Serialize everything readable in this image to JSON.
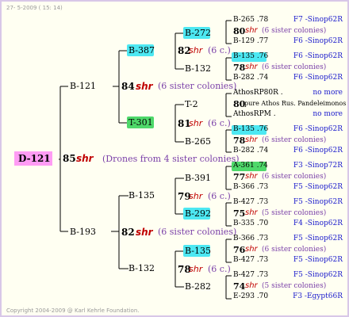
{
  "stamp": "27- 5-2009 ( 15: 14)",
  "copyright": "Copyright 2004-2009 @ Karl Kehrle Foundation.",
  "root": {
    "id": "D-121",
    "year": "85",
    "shr": "shr",
    "note": "(Drones from 4 sister colonies)"
  },
  "colors": {
    "cyan": "#4de8f2",
    "green": "#4ed86a",
    "root": "#ff9cf4",
    "lines": "#000000"
  },
  "gen1": [
    {
      "id": "B-121",
      "year": "84",
      "shr": "shr",
      "note": "(6 sister colonies)"
    },
    {
      "id": "B-193",
      "year": "82",
      "shr": "shr",
      "note": "(6 sister colonies)"
    }
  ],
  "gen2": [
    {
      "id": "B-387",
      "year": "82",
      "shr": "shr",
      "note": "(6 c.)"
    },
    {
      "id": "T-301",
      "year": "81",
      "shr": "shr",
      "note": "(6 c.)"
    },
    {
      "id": "B-135",
      "year": "79",
      "shr": "shr",
      "note": "(6 c.)"
    },
    {
      "id": "B-132",
      "year": "78",
      "shr": "shr",
      "note": "(6 c.)"
    }
  ],
  "gen3": [
    "B-272",
    "B-132",
    "T-2",
    "B-265",
    "B-391",
    "B-292",
    "B-135",
    "B-282"
  ],
  "gen4": [
    {
      "top": "B-265 .78",
      "top_r": "F7 -Sinop62R",
      "yr": "80",
      "note": "(6 sister colonies)",
      "bot": "B-129 .77",
      "bot_r": "F6 -Sinop62R"
    },
    {
      "top": "B-135 .76",
      "top_r": "F6 -Sinop62R",
      "yr": "78",
      "note": "(6 sister colonies)",
      "bot": "B-282 .74",
      "bot_r": "F6 -Sinop62R"
    },
    {
      "top": "AthosRP80R .",
      "top_r": "no more",
      "yr": "80",
      "note": "pure Athos Rus. Pandeleimonos",
      "bot": "AthosRPM .",
      "bot_r": "no more"
    },
    {
      "top": "B-135 .76",
      "top_r": "F6 -Sinop62R",
      "yr": "78",
      "note": "(6 sister colonies)",
      "bot": "B-282 .74",
      "bot_r": "F6 -Sinop62R"
    },
    {
      "top": "A-361 .74",
      "top_r": "F3 -Sinop72R",
      "yr": "77",
      "note": "(6 sister colonies)",
      "bot": "B-366 .73",
      "bot_r": "F5 -Sinop62R"
    },
    {
      "top": "B-427 .73",
      "top_r": "F5 -Sinop62R",
      "yr": "75",
      "note": "(5 sister colonies)",
      "bot": "B-335 .70",
      "bot_r": "F4 -Sinop62R"
    },
    {
      "top": "B-366 .73",
      "top_r": "F5 -Sinop62R",
      "yr": "76",
      "note": "(6 sister colonies)",
      "bot": "B-427 .73",
      "bot_r": "F5 -Sinop62R"
    },
    {
      "top": "B-427 .73",
      "top_r": "F5 -Sinop62R",
      "yr": "74",
      "note": "(5 sister colonies)",
      "bot": "E-293 .70",
      "bot_r": "F3 -Egypt66R"
    }
  ]
}
